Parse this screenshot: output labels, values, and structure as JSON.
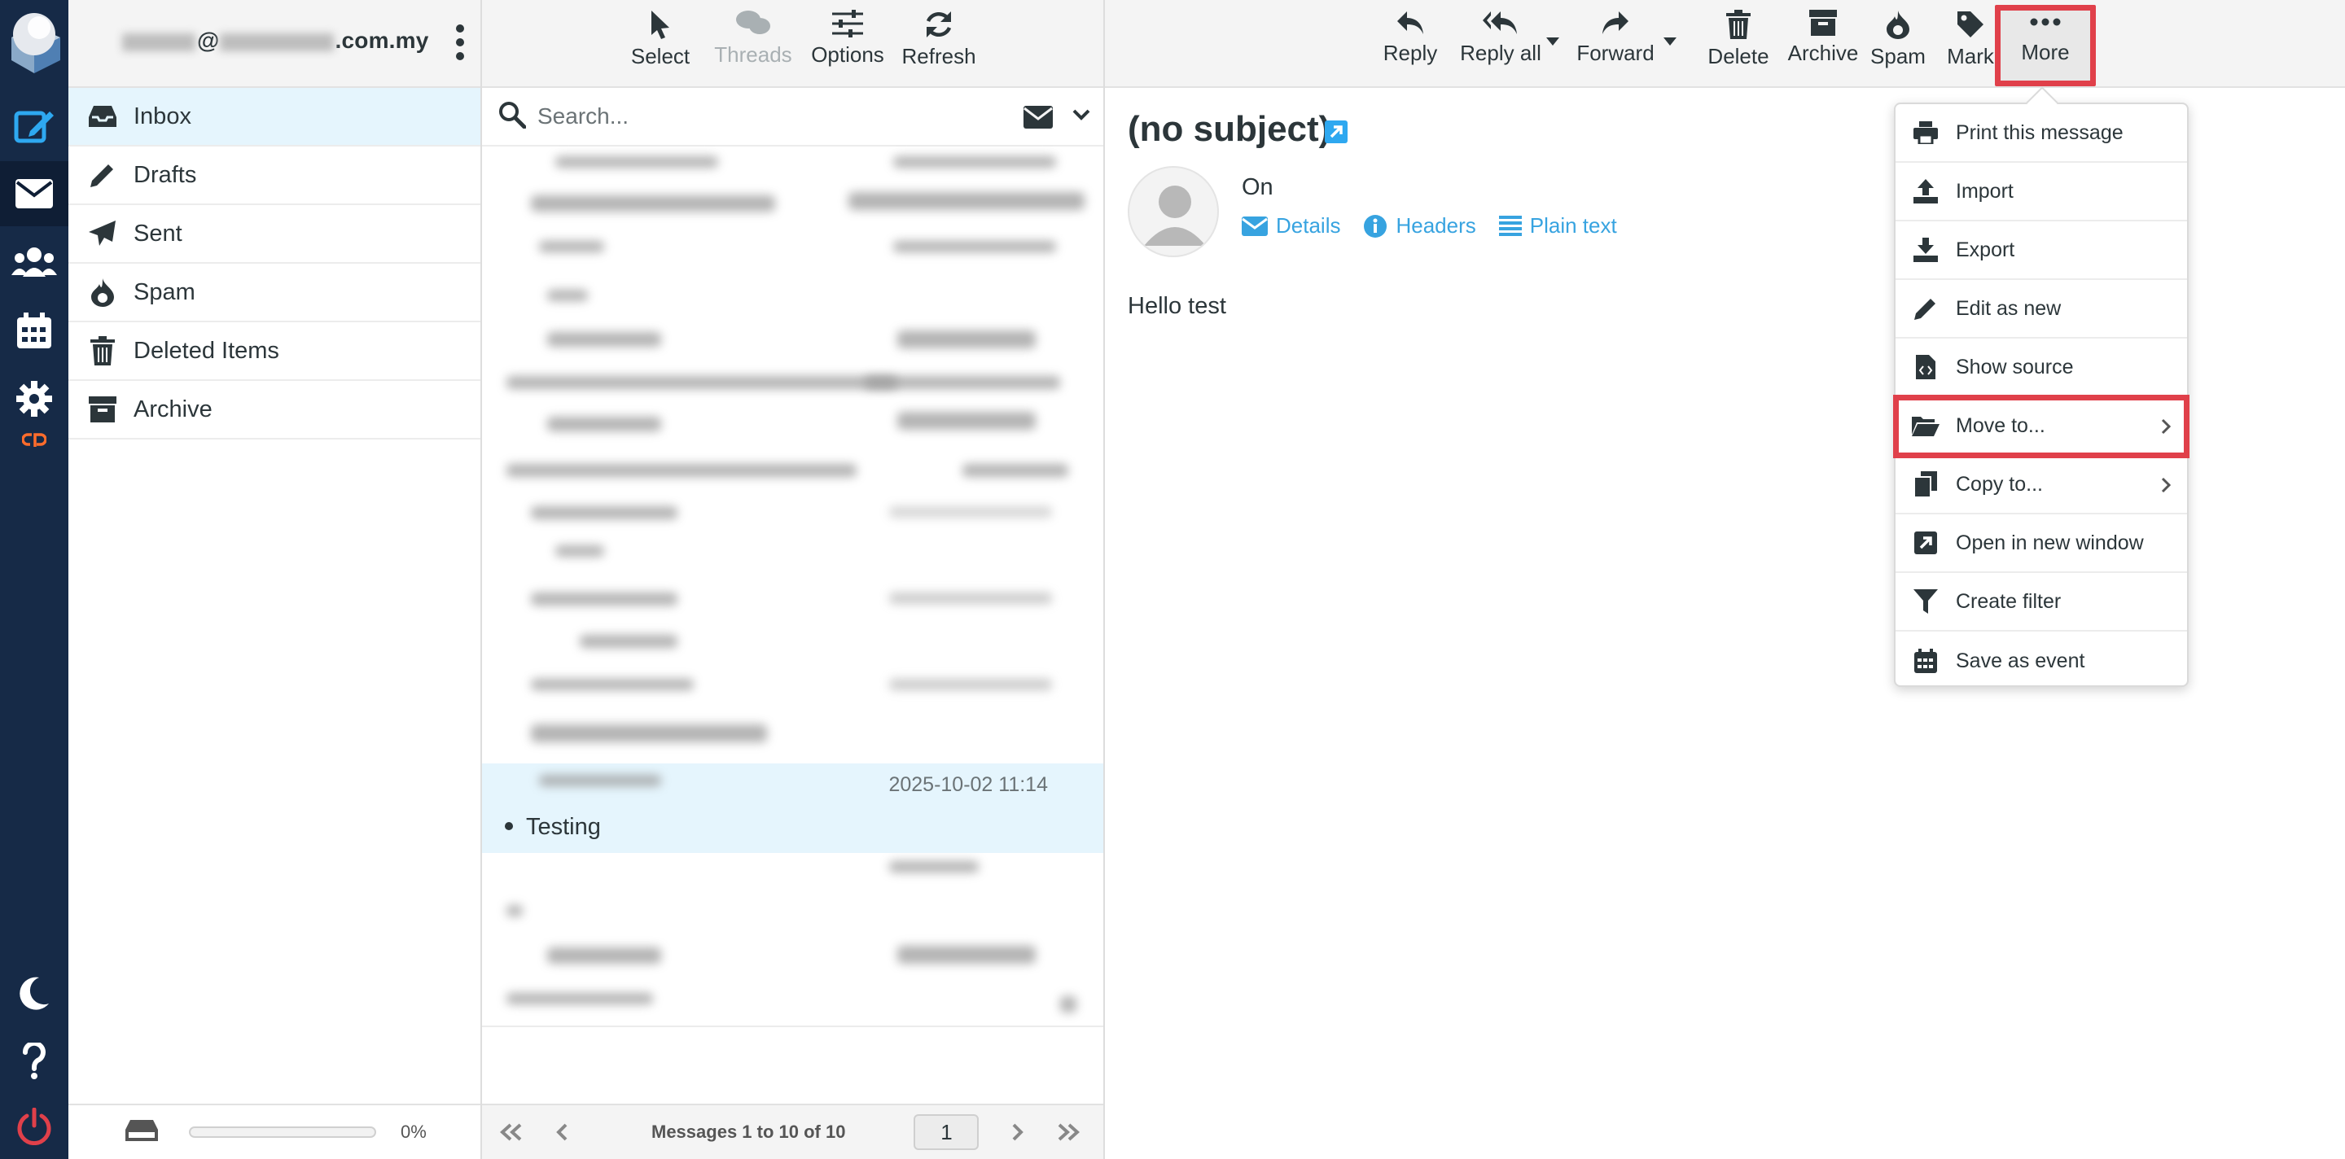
{
  "account": {
    "email_suffix": ".com.my",
    "email_at": "@"
  },
  "appbar": {
    "items": [
      "compose",
      "mail",
      "contacts",
      "calendar",
      "settings",
      "cpanel"
    ],
    "bottom": [
      "dark-mode",
      "help",
      "logout"
    ]
  },
  "folders": [
    {
      "label": "Inbox",
      "icon": "inbox-icon"
    },
    {
      "label": "Drafts",
      "icon": "pencil-icon"
    },
    {
      "label": "Sent",
      "icon": "paper-plane-icon"
    },
    {
      "label": "Spam",
      "icon": "fire-icon"
    },
    {
      "label": "Deleted Items",
      "icon": "trash-icon"
    },
    {
      "label": "Archive",
      "icon": "archive-box-icon"
    }
  ],
  "quota": {
    "percent_text": "0%"
  },
  "list_toolbar": {
    "select": "Select",
    "threads": "Threads",
    "options": "Options",
    "refresh": "Refresh"
  },
  "search": {
    "placeholder": "Search..."
  },
  "selected_message": {
    "date": "2025-10-02 11:14",
    "subject": "Testing"
  },
  "list_footer": {
    "count_text": "Messages 1 to 10 of 10",
    "page": "1"
  },
  "reader_toolbar": {
    "reply": "Reply",
    "reply_all": "Reply all",
    "forward": "Forward",
    "delete": "Delete",
    "archive": "Archive",
    "spam": "Spam",
    "mark": "Mark",
    "more": "More"
  },
  "message": {
    "subject": "(no subject)",
    "from_prefix": "On",
    "links": {
      "details": "Details",
      "headers": "Headers",
      "plain_text": "Plain text"
    },
    "body": "Hello test"
  },
  "more_menu": [
    {
      "label": "Print this message",
      "icon": "printer-icon"
    },
    {
      "label": "Import",
      "icon": "upload-icon"
    },
    {
      "label": "Export",
      "icon": "download-icon"
    },
    {
      "label": "Edit as new",
      "icon": "pencil-icon"
    },
    {
      "label": "Show source",
      "icon": "code-file-icon"
    },
    {
      "label": "Move to...",
      "icon": "folder-open-icon",
      "submenu": true,
      "highlighted": true
    },
    {
      "label": "Copy to...",
      "icon": "copy-icon",
      "submenu": true
    },
    {
      "label": "Open in new window",
      "icon": "external-window-icon"
    },
    {
      "label": "Create filter",
      "icon": "funnel-icon"
    },
    {
      "label": "Save as event",
      "icon": "calendar-icon"
    }
  ],
  "colors": {
    "sidebar": "#162a47",
    "accent": "#37a3e0",
    "selected_row": "#e5f5fd",
    "highlight": "#e0404a"
  }
}
